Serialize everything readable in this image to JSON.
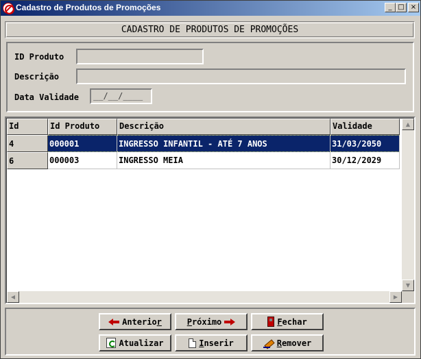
{
  "window": {
    "title": "Cadastro de Produtos de Promoções"
  },
  "header": {
    "title": "CADASTRO DE PRODUTOS DE PROMOÇÕES"
  },
  "form": {
    "id_produto_label": "ID Produto",
    "id_produto_value": "",
    "descricao_label": "Descrição",
    "descricao_value": "",
    "data_validade_label": "Data Validade",
    "data_validade_mask": "__/__/____"
  },
  "grid": {
    "columns": [
      "Id",
      "Id Produto",
      "Descrição",
      "Validade"
    ],
    "rows": [
      {
        "id": "4",
        "id_produto": "000001",
        "descricao": "INGRESSO INFANTIL - ATÉ 7 ANOS",
        "validade": "31/03/2050",
        "selected": true
      },
      {
        "id": "6",
        "id_produto": "000003",
        "descricao": "INGRESSO MEIA",
        "validade": "30/12/2029",
        "selected": false
      }
    ]
  },
  "buttons": {
    "anterior": {
      "pre": "Anterio",
      "key": "r",
      "post": ""
    },
    "proximo": {
      "pre": "",
      "key": "P",
      "post": "róximo"
    },
    "fechar": {
      "pre": "",
      "key": "F",
      "post": "echar"
    },
    "atualizar": {
      "pre": "",
      "key": "A",
      "post": "tualizar"
    },
    "inserir": {
      "pre": "",
      "key": "I",
      "post": "nserir"
    },
    "remover": {
      "pre": "",
      "key": "R",
      "post": "emover"
    }
  },
  "icons": {
    "app": "prohibition-icon",
    "anterior": "arrow-left-icon",
    "proximo": "arrow-right-icon",
    "fechar": "door-icon",
    "atualizar": "refresh-icon",
    "inserir": "new-document-icon",
    "remover": "eraser-icon"
  },
  "colors": {
    "title_bar": "#0a246a",
    "selection": "#0a246a",
    "face": "#d4d0c8"
  }
}
